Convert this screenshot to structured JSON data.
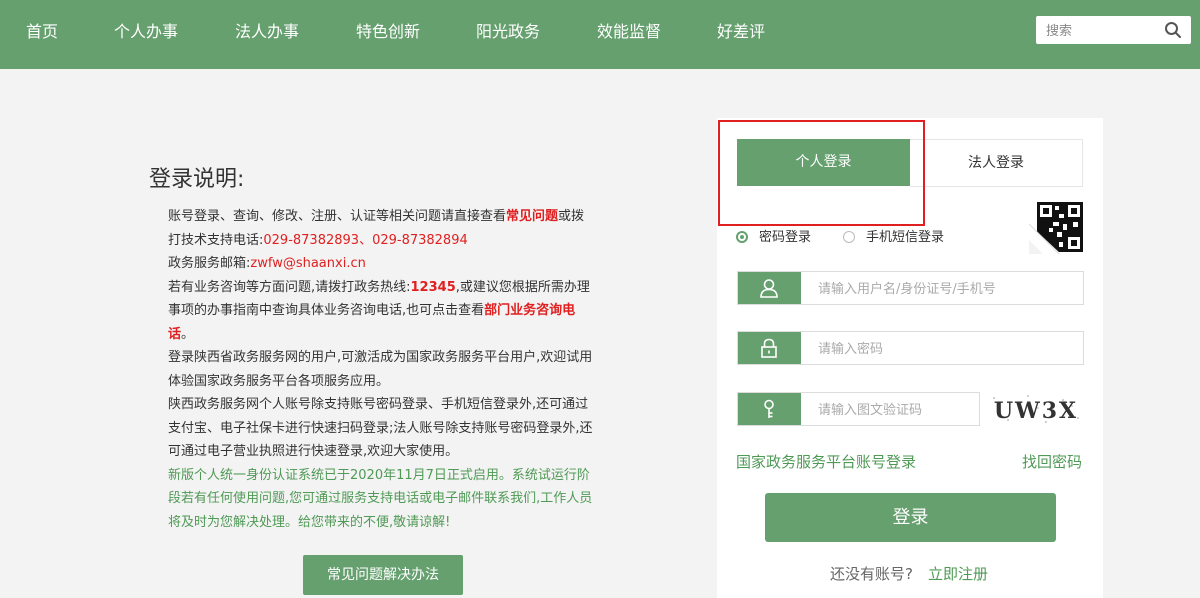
{
  "nav": {
    "items": [
      "首页",
      "个人办事",
      "法人办事",
      "特色创新",
      "阳光政务",
      "效能监督",
      "好差评"
    ],
    "search_placeholder": "搜索"
  },
  "info": {
    "title": "登录说明:",
    "p1_a": "账号登录、查询、修改、注册、认证等相关问题请直接查看",
    "p1_link": "常见问题",
    "p1_b": "或拨打技术支持电话:",
    "p1_phone": "029-87382893、029-87382894",
    "p2_label": "政务服务邮箱:",
    "p2_email": "zwfw@shaanxi.cn",
    "p3_a": "若有业务咨询等方面问题,请拨打政务热线:",
    "p3_hotline": "12345",
    "p3_b": ",或建议您根据所需办理事项的办事指南中查询具体业务咨询电话,也可点击查看",
    "p3_link": "部门业务咨询电话",
    "p3_c": "。",
    "p4": "登录陕西省政务服务网的用户,可激活成为国家政务服务平台用户,欢迎试用体验国家政务服务平台各项服务应用。",
    "p5": "陕西政务服务网个人账号除支持账号密码登录、手机短信登录外,还可通过支付宝、电子社保卡进行快速扫码登录;法人账号除支持账号密码登录外,还可通过电子营业执照进行快速登录,欢迎大家使用。",
    "p6": "新版个人统一身份认证系统已于2020年11月7日正式启用。系统试运行阶段若有任何使用问题,您可通过服务支持电话或电子邮件联系我们,工作人员将及时为您解决处理。给您带来的不便,敬请谅解!",
    "faq_button": "常见问题解决办法"
  },
  "login": {
    "tab_personal": "个人登录",
    "tab_legal": "法人登录",
    "radio_password": "密码登录",
    "radio_sms": "手机短信登录",
    "username_placeholder": "请输入用户名/身份证号/手机号",
    "password_placeholder": "请输入密码",
    "captcha_placeholder": "请输入图文验证码",
    "captcha_text": "UW3X",
    "national_link": "国家政务服务平台账号登录",
    "forgot_link": "找回密码",
    "login_button": "登录",
    "no_account": "还没有账号?",
    "register_link": "立即注册"
  },
  "colors": {
    "brand": "#66a06f",
    "highlight": "#e02020",
    "link": "#4f9a55"
  }
}
